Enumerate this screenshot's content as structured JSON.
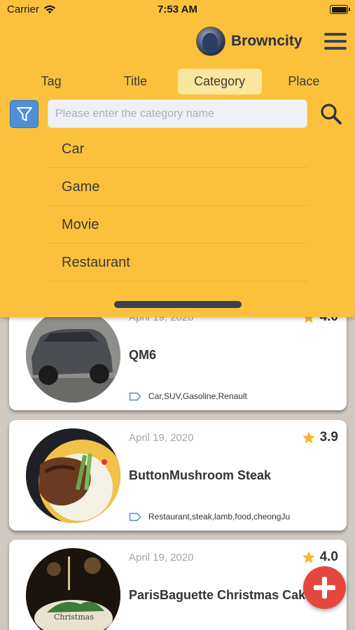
{
  "status_bar": {
    "carrier": "Carrier",
    "time": "7:53 AM"
  },
  "user": {
    "name": "Browncity"
  },
  "tabs": [
    {
      "label": "Tag",
      "active": false
    },
    {
      "label": "Title",
      "active": false
    },
    {
      "label": "Category",
      "active": true
    },
    {
      "label": "Place",
      "active": false
    }
  ],
  "search": {
    "placeholder": "Please enter the category name",
    "value": ""
  },
  "categories": [
    "Car",
    "Game",
    "Movie",
    "Restaurant"
  ],
  "posts": [
    {
      "date": "April 19, 2020",
      "rating": "4.0",
      "title": "QM6",
      "tags": "Car,SUV,Gasoline,Renault"
    },
    {
      "date": "April 19, 2020",
      "rating": "3.9",
      "title": "ButtonMushroom Steak",
      "tags": "Restaurant,steak,lamb,food,cheongJu"
    },
    {
      "date": "April 19, 2020",
      "rating": "4.0",
      "title": "ParisBaguette Christmas Cake",
      "tags": ""
    }
  ],
  "colors": {
    "panel": "#fcc13c",
    "tab_active": "#fbe69d",
    "filter_button": "#4d90d6",
    "fab": "#e5473f",
    "star": "#f7b731"
  },
  "icons": [
    "wifi-icon",
    "battery-icon",
    "menu-icon",
    "filter-icon",
    "search-icon",
    "tag-icon",
    "star-icon",
    "plus-icon"
  ]
}
